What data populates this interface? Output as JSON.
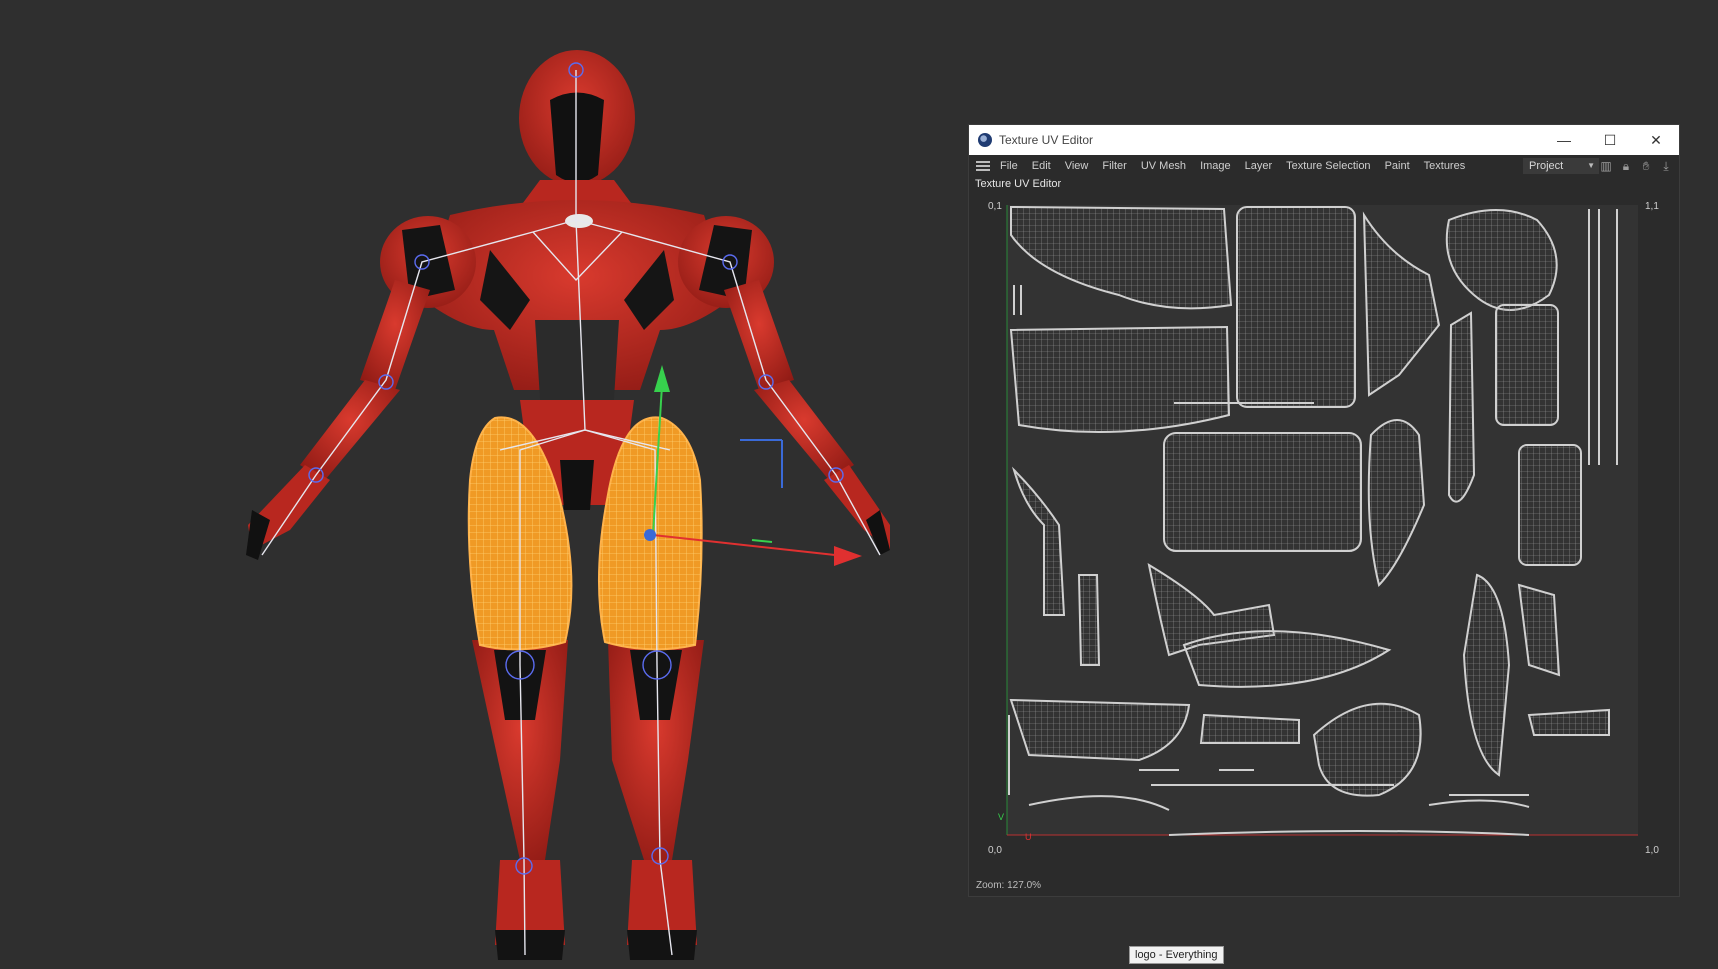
{
  "window": {
    "title": "Texture UV Editor",
    "controls": {
      "minimize": "—",
      "maximize": "☐",
      "close": "✕"
    }
  },
  "menu": [
    "File",
    "Edit",
    "View",
    "Filter",
    "UV Mesh",
    "Image",
    "Layer",
    "Texture Selection",
    "Paint",
    "Textures"
  ],
  "project_select": "Project",
  "panel_label": "Texture UV Editor",
  "uv_corners": {
    "top_left": "0,1",
    "top_right": "1,1",
    "bottom_left": "0,0",
    "bottom_right": "1,0",
    "axis_v": "V",
    "axis_u": "U"
  },
  "zoom": "Zoom: 127.0%",
  "tooltip": "logo - Everything",
  "colors": {
    "background": "#2f2f2f",
    "character_red": "#c42b22",
    "selection_orange": "#f09a25",
    "uv_lines": "#c8c8c8",
    "axis_green": "#37d04d",
    "axis_red": "#e03030",
    "axis_blue": "#3a6ad8"
  },
  "icons": {
    "app": "cinema4d-icon",
    "menu": "hamburger-icon",
    "tools": [
      "histogram-icon",
      "lock-icon",
      "hand-icon",
      "pin-icon"
    ]
  }
}
